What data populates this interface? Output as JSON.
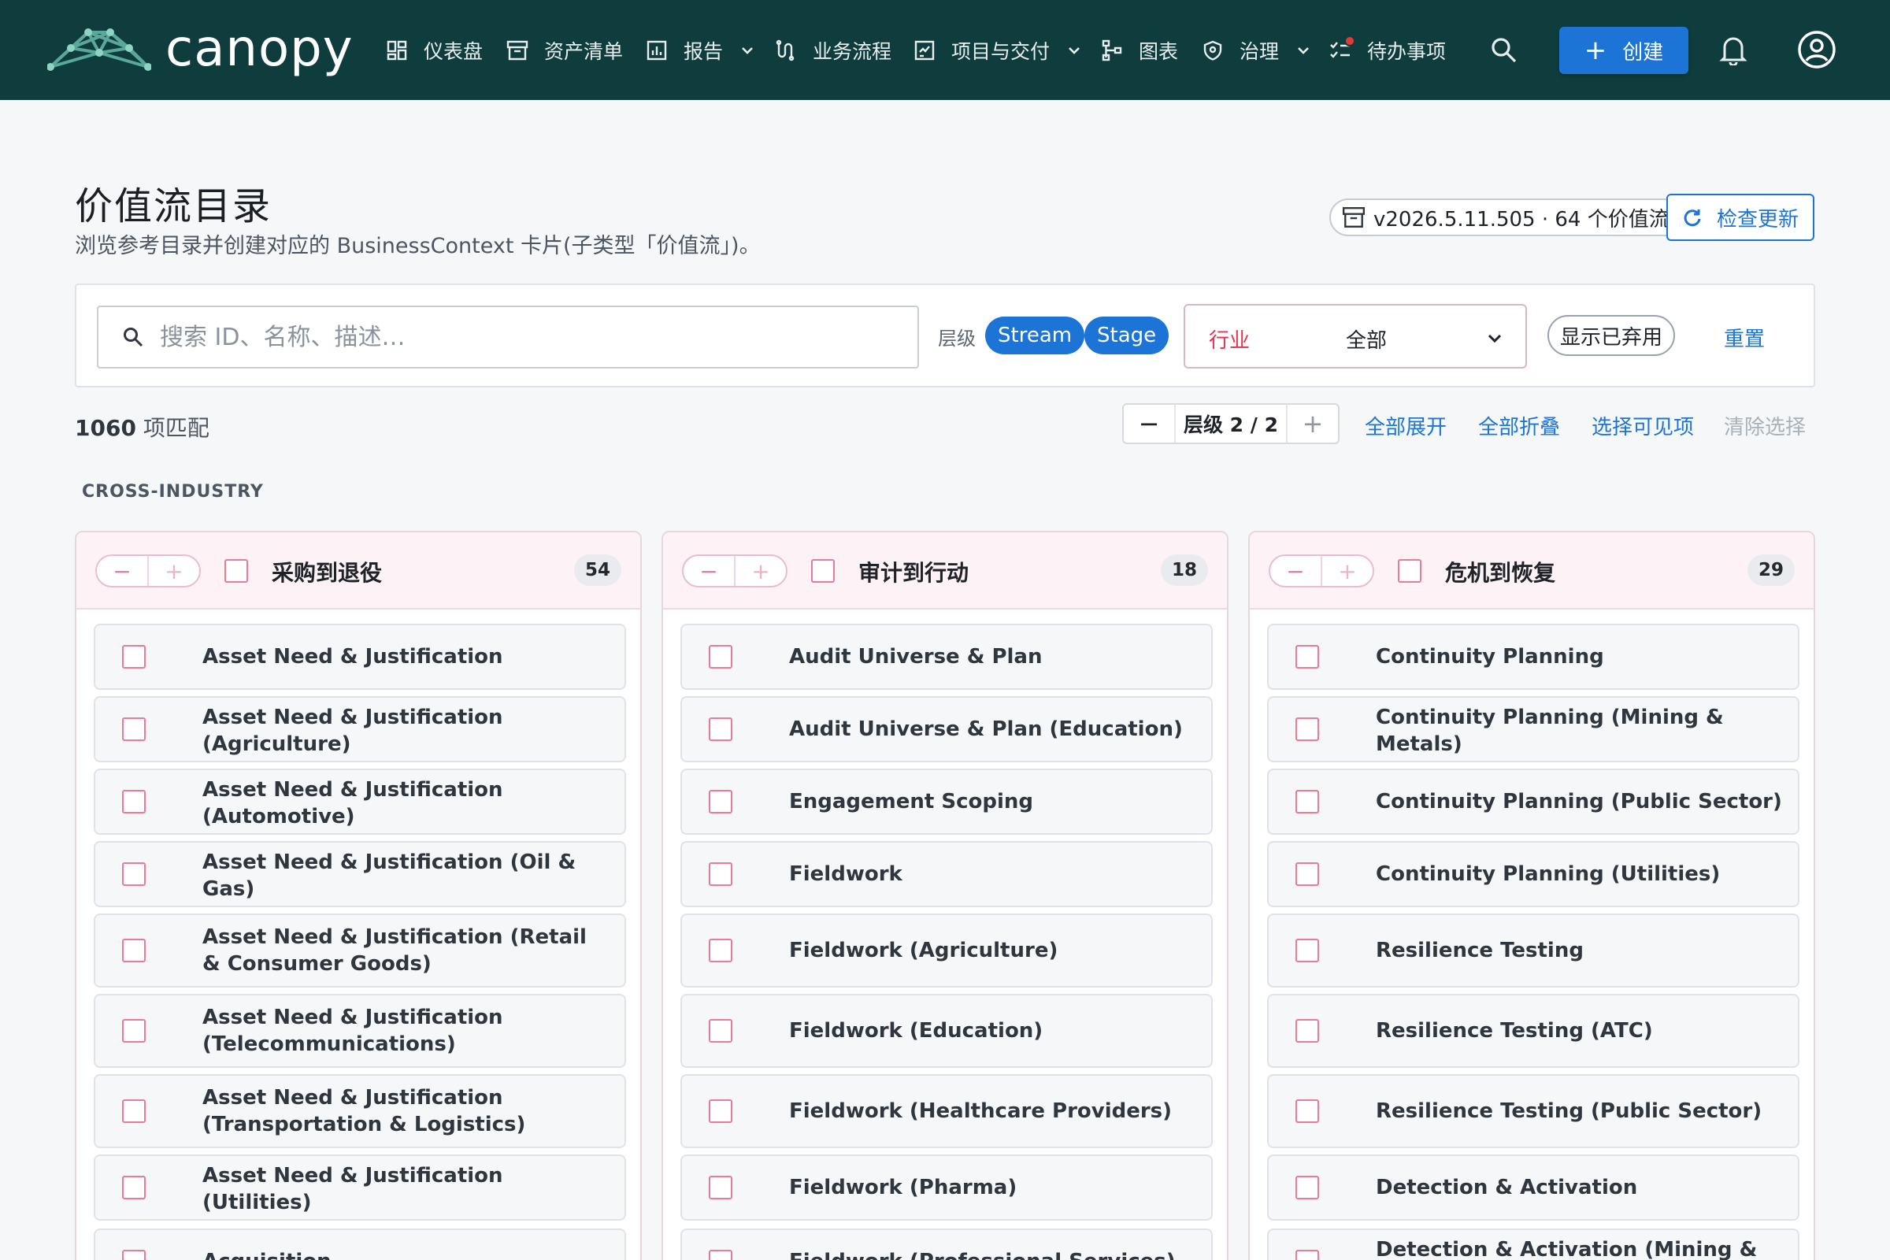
{
  "brand": {
    "name": "canopy"
  },
  "nav": {
    "items": [
      {
        "label": "仪表盘",
        "icon": "dashboard-icon",
        "has_menu": false
      },
      {
        "label": "资产清单",
        "icon": "archive-icon",
        "has_menu": false
      },
      {
        "label": "报告",
        "icon": "report-icon",
        "has_menu": true
      },
      {
        "label": "业务流程",
        "icon": "process-icon",
        "has_menu": false
      },
      {
        "label": "项目与交付",
        "icon": "project-icon",
        "has_menu": true
      },
      {
        "label": "图表",
        "icon": "diagram-icon",
        "has_menu": false
      },
      {
        "label": "治理",
        "icon": "shield-icon",
        "has_menu": true
      },
      {
        "label": "待办事项",
        "icon": "todo-icon",
        "has_menu": false,
        "has_dot": true
      }
    ],
    "create_label": "创建",
    "accent": "#1b74d6",
    "bar_color": "#0f3d3e"
  },
  "page": {
    "title": "价值流目录",
    "subtitle": "浏览参考目录并创建对应的 BusinessContext 卡片(子类型「价值流」)。",
    "version": "v2026.5.11.505 · 64 个价值流",
    "check_update": "检查更新"
  },
  "filters": {
    "search_placeholder": "搜索 ID、名称、描述…",
    "level_label": "层级",
    "level_chips": [
      "Stream",
      "Stage"
    ],
    "industry_label": "行业",
    "industry_value": "全部",
    "show_deprecated": "显示已弃用",
    "reset": "重置"
  },
  "toolbar": {
    "match_number": "1060",
    "match_suffix": " 项匹配",
    "level_stepper": "层级 2 / 2",
    "expand_all": "全部展开",
    "collapse_all": "全部折叠",
    "select_visible": "选择可见项",
    "clear_selection": "清除选择"
  },
  "section": {
    "label": "CROSS-INDUSTRY"
  },
  "columns": [
    {
      "title": "采购到退役",
      "count": "54",
      "items": [
        "Asset Need & Justification",
        "Asset Need & Justification (Agriculture)",
        "Asset Need & Justification (Automotive)",
        "Asset Need & Justification (Oil & Gas)",
        "Asset Need & Justification (Retail & Consumer Goods)",
        "Asset Need & Justification (Telecommunications)",
        "Asset Need & Justification (Transportation & Logistics)",
        "Asset Need & Justification (Utilities)",
        "Acquisition"
      ]
    },
    {
      "title": "审计到行动",
      "count": "18",
      "items": [
        "Audit Universe & Plan",
        "Audit Universe & Plan (Education)",
        "Engagement Scoping",
        "Fieldwork",
        "Fieldwork (Agriculture)",
        "Fieldwork (Education)",
        "Fieldwork (Healthcare Providers)",
        "Fieldwork (Pharma)",
        "Fieldwork (Professional Services)"
      ]
    },
    {
      "title": "危机到恢复",
      "count": "29",
      "items": [
        "Continuity Planning",
        "Continuity Planning (Mining & Metals)",
        "Continuity Planning (Public Sector)",
        "Continuity Planning (Utilities)",
        "Resilience Testing",
        "Resilience Testing (ATC)",
        "Resilience Testing (Public Sector)",
        "Detection & Activation",
        "Detection & Activation (Mining & Metals)"
      ]
    }
  ]
}
